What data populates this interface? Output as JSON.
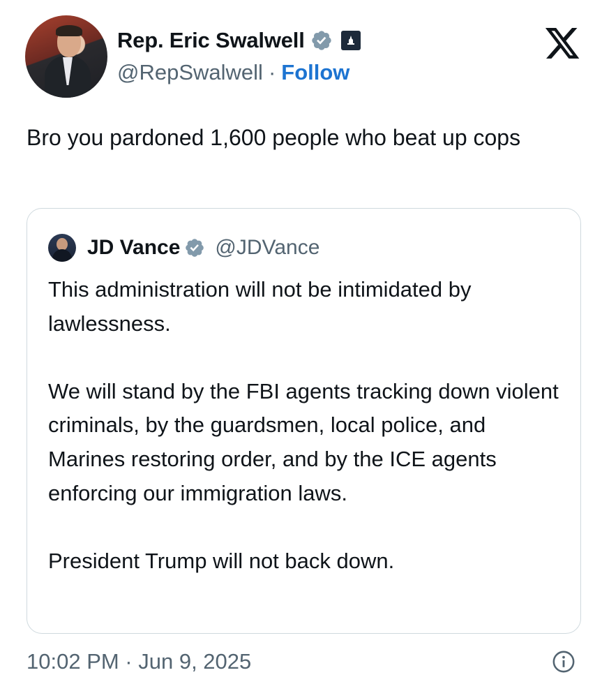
{
  "author": {
    "display_name": "Rep. Eric Swalwell",
    "handle": "@RepSwalwell",
    "separator": "·",
    "follow_label": "Follow"
  },
  "tweet": {
    "text": "Bro you pardoned 1,600 people who beat up cops"
  },
  "quoted": {
    "display_name": "JD Vance",
    "handle": "@JDVance",
    "paragraphs": [
      "This administration will not be intimidated by lawlessness.",
      "We will stand by the FBI agents tracking down violent criminals, by the guardsmen, local police, and Marines restoring order, and by the ICE agents enforcing our immigration laws.",
      "President Trump will not back down."
    ]
  },
  "footer": {
    "timestamp": "10:02 PM · Jun 9, 2025"
  },
  "icons": {
    "verified": "verified-badge-icon",
    "government": "government-badge-icon",
    "x_logo": "x-logo-icon",
    "info": "info-icon"
  },
  "colors": {
    "follow": "#1d74d1",
    "secondary_text": "#536471",
    "verified_badge": "#829aab",
    "border": "#cfd9de"
  }
}
